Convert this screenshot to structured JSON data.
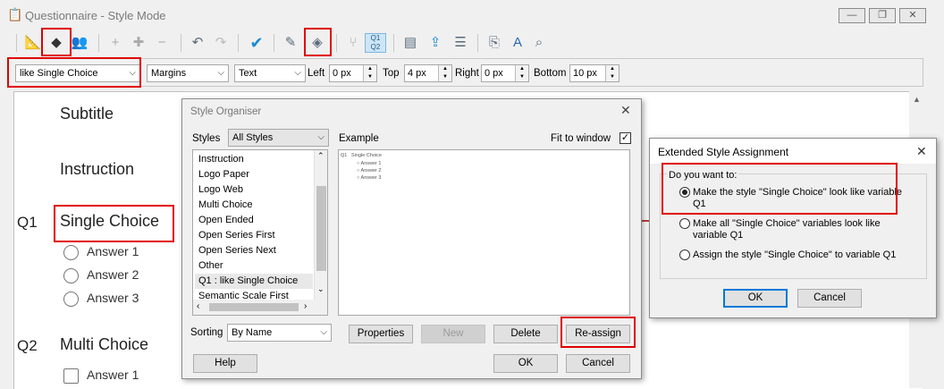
{
  "main_window": {
    "title": "Questionnaire - Style Mode",
    "minimize": "—",
    "restore": "❐",
    "close": "✕"
  },
  "format_bar": {
    "style_combo": "like Single Choice",
    "margins_combo": "Margins",
    "text_combo": "Text",
    "left_label": "Left",
    "left_value": "0 px",
    "top_label": "Top",
    "top_value": "4 px",
    "right_label": "Right",
    "right_value": "0 px",
    "bottom_label": "Bottom",
    "bottom_value": "10 px"
  },
  "toolbar": {
    "q1q2_label_top": "Q1",
    "q1q2_label_bottom": "Q2"
  },
  "canvas": {
    "subtitle": "Subtitle",
    "instruction": "Instruction",
    "q1": {
      "number": "Q1",
      "text": "Single Choice",
      "answers": [
        "Answer 1",
        "Answer 2",
        "Answer 3"
      ]
    },
    "q2": {
      "number": "Q2",
      "text": "Multi Choice",
      "answers": [
        "Answer 1"
      ]
    }
  },
  "style_organiser": {
    "title": "Style Organiser",
    "styles_label": "Styles",
    "styles_combo": "All Styles",
    "example_label": "Example",
    "fit_label": "Fit to window",
    "items": [
      "Instruction",
      "Logo Paper",
      "Logo Web",
      "Multi Choice",
      "Open Ended",
      "Open Series First",
      "Open Series Next",
      "Other",
      "Q1 : like Single Choice",
      "Semantic Scale First"
    ],
    "example": {
      "q": "Q1",
      "text": "Single Choice",
      "answers": [
        "Answer 1",
        "Answer 2",
        "Answer 3"
      ]
    },
    "sorting_label": "Sorting",
    "sorting_combo": "By Name",
    "properties": "Properties",
    "new": "New",
    "delete": "Delete",
    "reassign": "Re-assign",
    "help": "Help",
    "ok": "OK",
    "cancel": "Cancel"
  },
  "extended_assignment": {
    "title": "Extended Style Assignment",
    "group_label": "Do you want to:",
    "options": [
      "Make the style \"Single Choice\" look like variable Q1",
      "Make all \"Single Choice\" variables look like variable Q1",
      "Assign the style \"Single Choice\" to variable Q1"
    ],
    "selected_index": 0,
    "ok": "OK",
    "cancel": "Cancel"
  },
  "colors": {
    "highlight": "#e00000",
    "accent": "#0078d7"
  }
}
